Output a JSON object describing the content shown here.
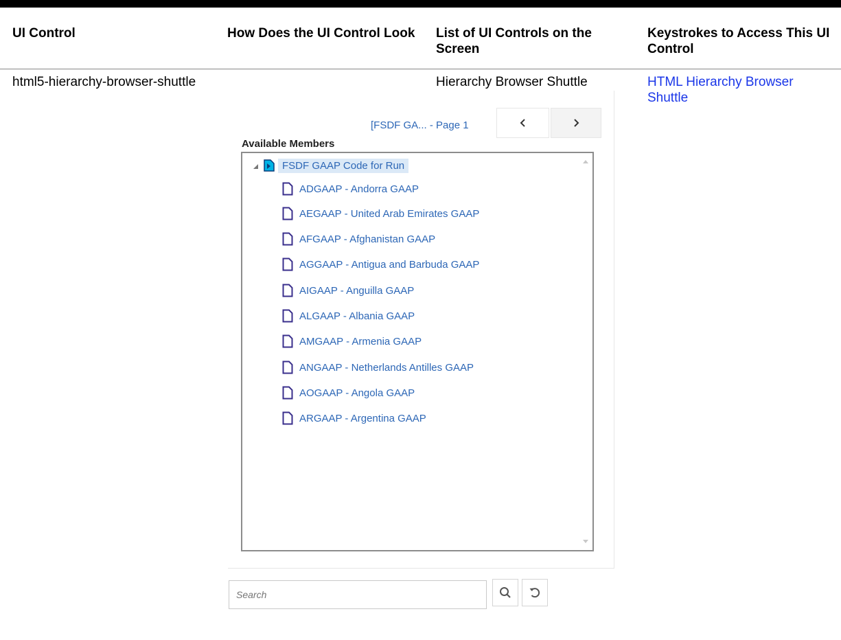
{
  "table": {
    "headers": [
      "UI Control",
      "How Does the UI Control Look",
      "List of UI Controls on the Screen",
      "Keystrokes to Access This UI Control"
    ],
    "row": {
      "control": "html5-hierarchy-browser-shuttle",
      "list": "Hierarchy Browser Shuttle",
      "keystrokes_link": "HTML Hierarchy Browser Shuttle"
    }
  },
  "widget": {
    "pager_text": "[FSDF GA... - Page 1",
    "available_label": "Available Members",
    "root_label": "FSDF GAAP Code for Run",
    "items": [
      "ADGAAP - Andorra GAAP",
      "AEGAAP - United Arab Emirates GAAP",
      "AFGAAP - Afghanistan GAAP",
      "AGGAAP - Antigua and Barbuda GAAP",
      "AIGAAP - Anguilla GAAP",
      "ALGAAP - Albania GAAP",
      "AMGAAP - Armenia GAAP",
      "ANGAAP - Netherlands Antilles GAAP",
      "AOGAAP - Angola GAAP",
      "ARGAAP - Argentina GAAP"
    ],
    "search_placeholder": "Search",
    "colors": {
      "link": "#1a36e8",
      "item_text": "#2d67b6",
      "selected_bg": "#dbe9f7",
      "root_icon": "#00b4e6",
      "doc_icon": "#3a2f8c"
    },
    "icons": {
      "prev": "chevron-left-icon",
      "next": "chevron-right-icon",
      "expander": "expanded-triangle-icon",
      "root": "folder-document-icon",
      "item": "document-icon",
      "search": "search-icon",
      "reset": "reset-icon"
    }
  }
}
